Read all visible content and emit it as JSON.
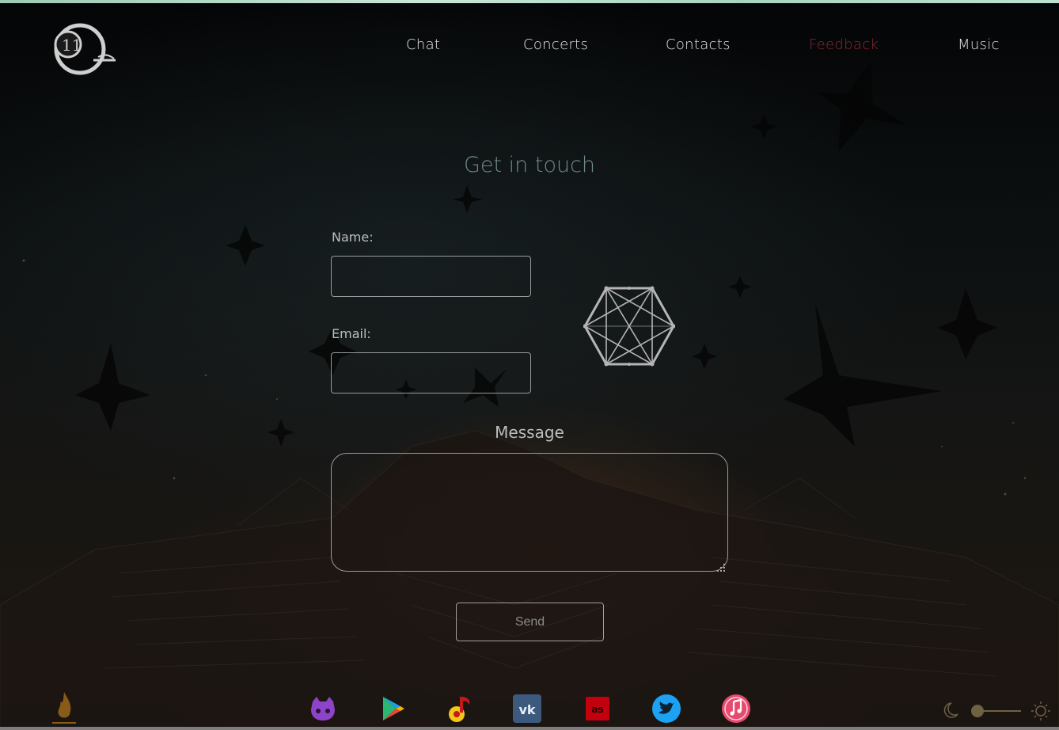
{
  "nav": {
    "items": [
      {
        "label": "Chat",
        "active": false
      },
      {
        "label": "Concerts",
        "active": false
      },
      {
        "label": "Contacts",
        "active": false
      },
      {
        "label": "Feedback",
        "active": true
      },
      {
        "label": "Music",
        "active": false
      }
    ]
  },
  "form": {
    "heading": "Get in touch",
    "name_label": "Name:",
    "name_value": "",
    "email_label": "Email:",
    "email_value": "",
    "message_label": "Message",
    "message_value": "",
    "send_label": "Send"
  },
  "social": [
    {
      "icon": "github-icon"
    },
    {
      "icon": "google-play-icon"
    },
    {
      "icon": "yandex-music-icon"
    },
    {
      "icon": "vk-icon"
    },
    {
      "icon": "lastfm-icon"
    },
    {
      "icon": "twitter-icon"
    },
    {
      "icon": "apple-music-icon"
    }
  ],
  "theme": {
    "left_icon": "moon-icon",
    "right_icon": "sun-icon"
  },
  "colors": {
    "active_nav": "#8a2a33",
    "heading": "#6f8a86",
    "github": "#8e44c8",
    "vk": "#3b5a7e",
    "lastfm": "#c3000d",
    "twitter": "#1da1f2",
    "itunes": "#e84a6f"
  }
}
